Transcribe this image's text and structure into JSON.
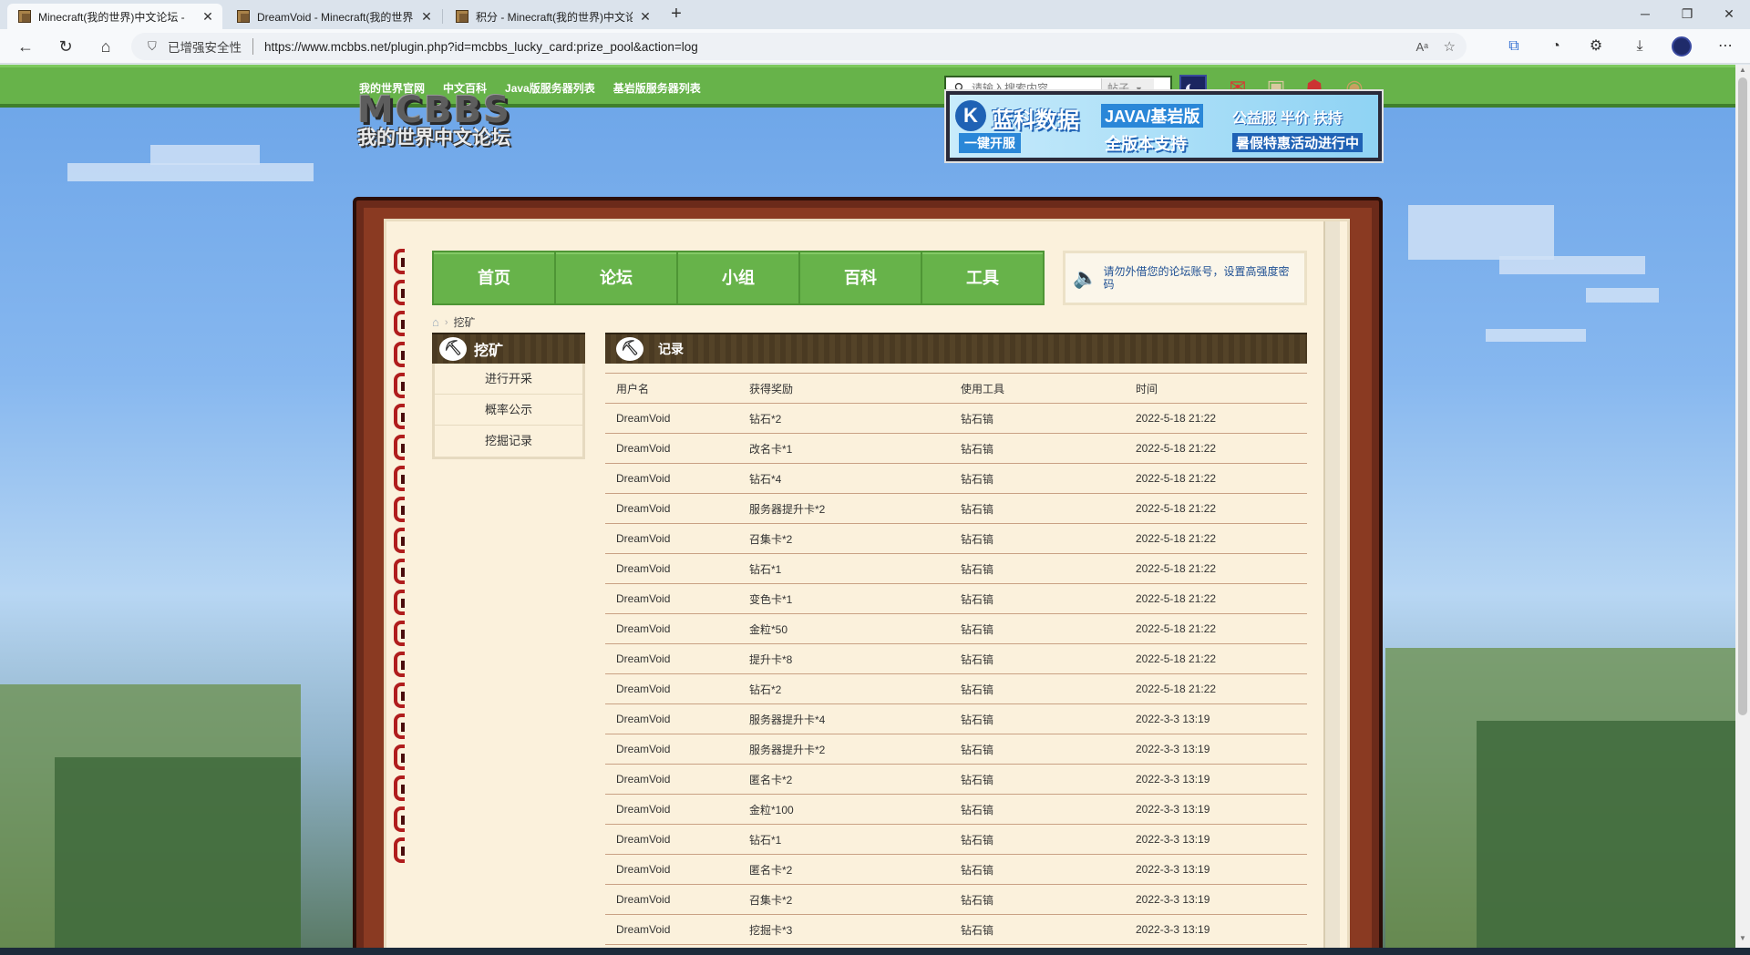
{
  "browser": {
    "tabs": [
      {
        "title": "Minecraft(我的世界)中文论坛 -",
        "active": true
      },
      {
        "title": "DreamVoid - Minecraft(我的世界",
        "active": false
      },
      {
        "title": "积分 - Minecraft(我的世界)中文论",
        "active": false
      }
    ],
    "security_label": "已增强安全性",
    "url": "https://www.mcbbs.net/plugin.php?id=mcbbs_lucky_card:prize_pool&action=log"
  },
  "topbar": {
    "links": [
      "我的世界官网",
      "中文百科",
      "Java版服务器列表",
      "基岩版服务器列表"
    ],
    "search_placeholder": "请输入搜索内容",
    "search_type": "帖子"
  },
  "logo": {
    "line1": "MCBBS",
    "line2": "我的世界中文论坛"
  },
  "banner": {
    "brand": "蓝科数据",
    "tag1": "JAVA/基岩版",
    "tag2": "公益服 半价 扶持",
    "btn": "一键开服",
    "tag3": "全版本支持",
    "tag4": "暑假特惠活动进行中"
  },
  "mainnav": [
    "首页",
    "论坛",
    "小组",
    "百科",
    "工具"
  ],
  "notice": "请勿外借您的论坛账号，设置高强度密码",
  "breadcrumb": {
    "current": "挖矿"
  },
  "sidebar": {
    "title": "挖矿",
    "items": [
      "进行开采",
      "概率公示",
      "挖掘记录"
    ]
  },
  "records": {
    "title": "记录",
    "columns": [
      "用户名",
      "获得奖励",
      "使用工具",
      "时间"
    ],
    "rows": [
      [
        "DreamVoid",
        "钻石*2",
        "钻石镐",
        "2022-5-18 21:22"
      ],
      [
        "DreamVoid",
        "改名卡*1",
        "钻石镐",
        "2022-5-18 21:22"
      ],
      [
        "DreamVoid",
        "钻石*4",
        "钻石镐",
        "2022-5-18 21:22"
      ],
      [
        "DreamVoid",
        "服务器提升卡*2",
        "钻石镐",
        "2022-5-18 21:22"
      ],
      [
        "DreamVoid",
        "召集卡*2",
        "钻石镐",
        "2022-5-18 21:22"
      ],
      [
        "DreamVoid",
        "钻石*1",
        "钻石镐",
        "2022-5-18 21:22"
      ],
      [
        "DreamVoid",
        "变色卡*1",
        "钻石镐",
        "2022-5-18 21:22"
      ],
      [
        "DreamVoid",
        "金粒*50",
        "钻石镐",
        "2022-5-18 21:22"
      ],
      [
        "DreamVoid",
        "提升卡*8",
        "钻石镐",
        "2022-5-18 21:22"
      ],
      [
        "DreamVoid",
        "钻石*2",
        "钻石镐",
        "2022-5-18 21:22"
      ],
      [
        "DreamVoid",
        "服务器提升卡*4",
        "钻石镐",
        "2022-3-3 13:19"
      ],
      [
        "DreamVoid",
        "服务器提升卡*2",
        "钻石镐",
        "2022-3-3 13:19"
      ],
      [
        "DreamVoid",
        "匿名卡*2",
        "钻石镐",
        "2022-3-3 13:19"
      ],
      [
        "DreamVoid",
        "金粒*100",
        "钻石镐",
        "2022-3-3 13:19"
      ],
      [
        "DreamVoid",
        "钻石*1",
        "钻石镐",
        "2022-3-3 13:19"
      ],
      [
        "DreamVoid",
        "匿名卡*2",
        "钻石镐",
        "2022-3-3 13:19"
      ],
      [
        "DreamVoid",
        "召集卡*2",
        "钻石镐",
        "2022-3-3 13:19"
      ],
      [
        "DreamVoid",
        "挖掘卡*3",
        "钻石镐",
        "2022-3-3 13:19"
      ]
    ]
  }
}
